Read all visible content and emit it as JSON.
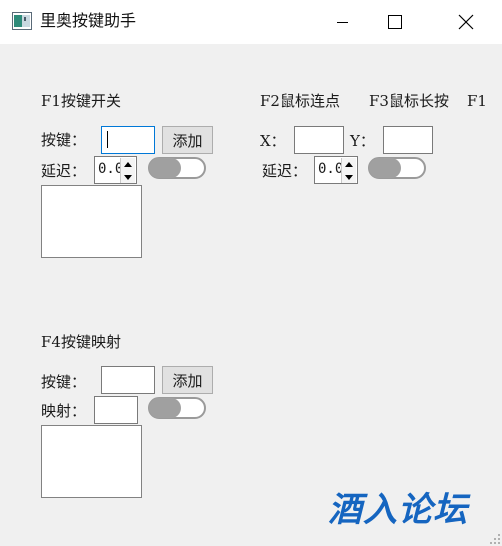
{
  "window": {
    "title": "里奥按键助手",
    "icon": "app-icon",
    "controls": [
      "minimize-icon",
      "maximize-icon",
      "close-icon"
    ]
  },
  "f1": {
    "title": "F1按键开关",
    "key_label": "按键：",
    "key_value": "",
    "add_label": "添加",
    "delay_label": "延迟：",
    "delay_value": "0.0",
    "toggle_on": false
  },
  "f2": {
    "title": "F2鼠标连点",
    "x_label": "X：",
    "x_value": "",
    "y_label": "Y：",
    "y_value": "",
    "delay_label": "延迟：",
    "delay_value": "0.0",
    "toggle_on": false
  },
  "f3": {
    "title": "F3鼠标长按"
  },
  "f1b": {
    "title": "F1"
  },
  "f4": {
    "title": "F4按键映射",
    "key_label": "按键：",
    "key_value": "",
    "add_label": "添加",
    "map_label": "映射：",
    "map_value": "",
    "toggle_on": false
  },
  "watermark": "酒入论坛",
  "colors": {
    "accent": "#0078d7",
    "watermark": "#1565c0",
    "toggle_knob": "#a0a0a0"
  }
}
